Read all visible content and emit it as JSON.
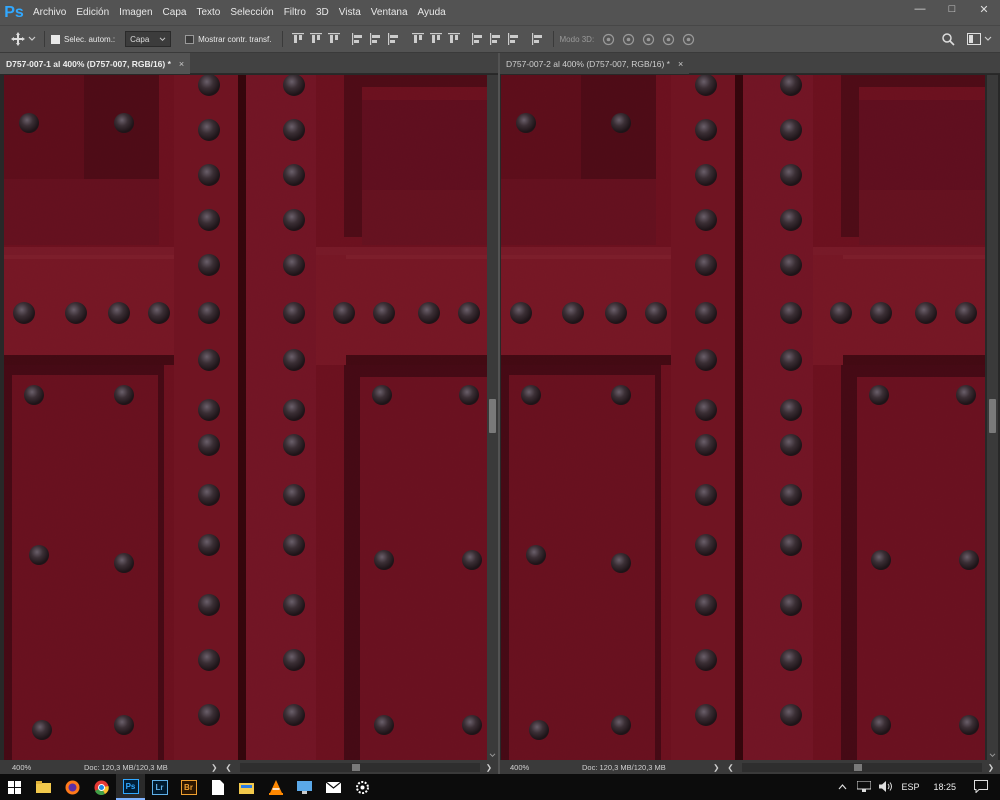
{
  "app": {
    "logo": "Ps"
  },
  "menu": [
    "Archivo",
    "Edición",
    "Imagen",
    "Capa",
    "Texto",
    "Selección",
    "Filtro",
    "3D",
    "Vista",
    "Ventana",
    "Ayuda"
  ],
  "window_controls": {
    "minimize": "—",
    "restore": "□",
    "close": "✕"
  },
  "options": {
    "auto_select_label": "Selec. autom.:",
    "auto_select_checked": true,
    "auto_select_target": "Capa",
    "transform_controls_label": "Mostrar contr. transf.",
    "transform_controls_checked": false,
    "mode_3d_label": "Modo 3D:"
  },
  "documents": [
    {
      "tab_title": "D757-007-1 al 400% (D757-007, RGB/16) *",
      "zoom": "400%",
      "doc_info": "Doc: 120,3 MB/120,3 MB",
      "active": true
    },
    {
      "tab_title": "D757-007-2 al 400% (D757-007, RGB/16) *",
      "zoom": "400%",
      "doc_info": "Doc: 120,3 MB/120,3 MB",
      "active": false
    }
  ],
  "status_arrows": {
    "right": "❯",
    "left": "❮",
    "right2": "❯"
  },
  "tab_close_glyph": "×",
  "taskbar": {
    "apps": [
      "windows-start",
      "file-explorer",
      "firefox",
      "chrome",
      "photoshop",
      "lightroom",
      "bridge",
      "document",
      "explorer-folder",
      "vlc",
      "pc-monitor",
      "mail",
      "settings"
    ],
    "app_labels": {
      "photoshop": "Ps",
      "lightroom": "Lr",
      "bridge": "Br"
    },
    "tray_language": "ESP",
    "tray_time": "18:25"
  },
  "colors": {
    "ui_bg": "#535353",
    "panel_dark": "#282828",
    "door_red": "#6e1320",
    "ps_blue": "#31a8ff"
  }
}
